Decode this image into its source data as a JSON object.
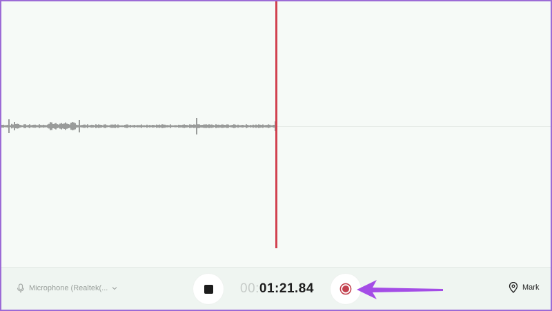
{
  "recorder": {
    "microphone_label": "Microphone (Realtek(...",
    "timer_dim": "00:",
    "timer_main": "01:21.84",
    "mark_label": "Mark"
  },
  "colors": {
    "playhead": "#d1414f",
    "record": "#c2414e",
    "annotation_arrow": "#a44de6"
  },
  "icons": {
    "microphone": "microphone-icon",
    "chevron": "chevron-down-icon",
    "stop": "stop-icon",
    "record": "record-icon",
    "mark": "location-pin-icon"
  }
}
